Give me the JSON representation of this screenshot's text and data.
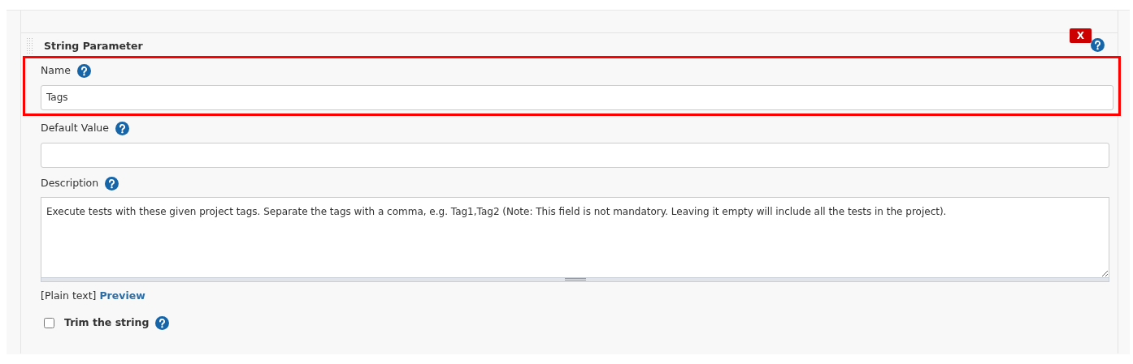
{
  "section": {
    "title": "String Parameter",
    "delete_button": "X"
  },
  "fields": [
    {
      "kind": "input",
      "label": "Name",
      "value": "Tags",
      "highlighted": true
    },
    {
      "kind": "input",
      "label": "Default Value",
      "highlighted": false
    },
    {
      "kind": "textarea",
      "label": "Description",
      "value": "Execute tests with these given project tags. Separate the tags with a comma, e.g. Tag1,Tag2 (Note: This field is not mandatory. Leaving it empty will include all the tests in the project).",
      "highlighted": false
    }
  ],
  "format": {
    "note": "[Plain text]",
    "link": "Preview"
  },
  "trim": {
    "label": "Trim the string",
    "checked": false
  }
}
